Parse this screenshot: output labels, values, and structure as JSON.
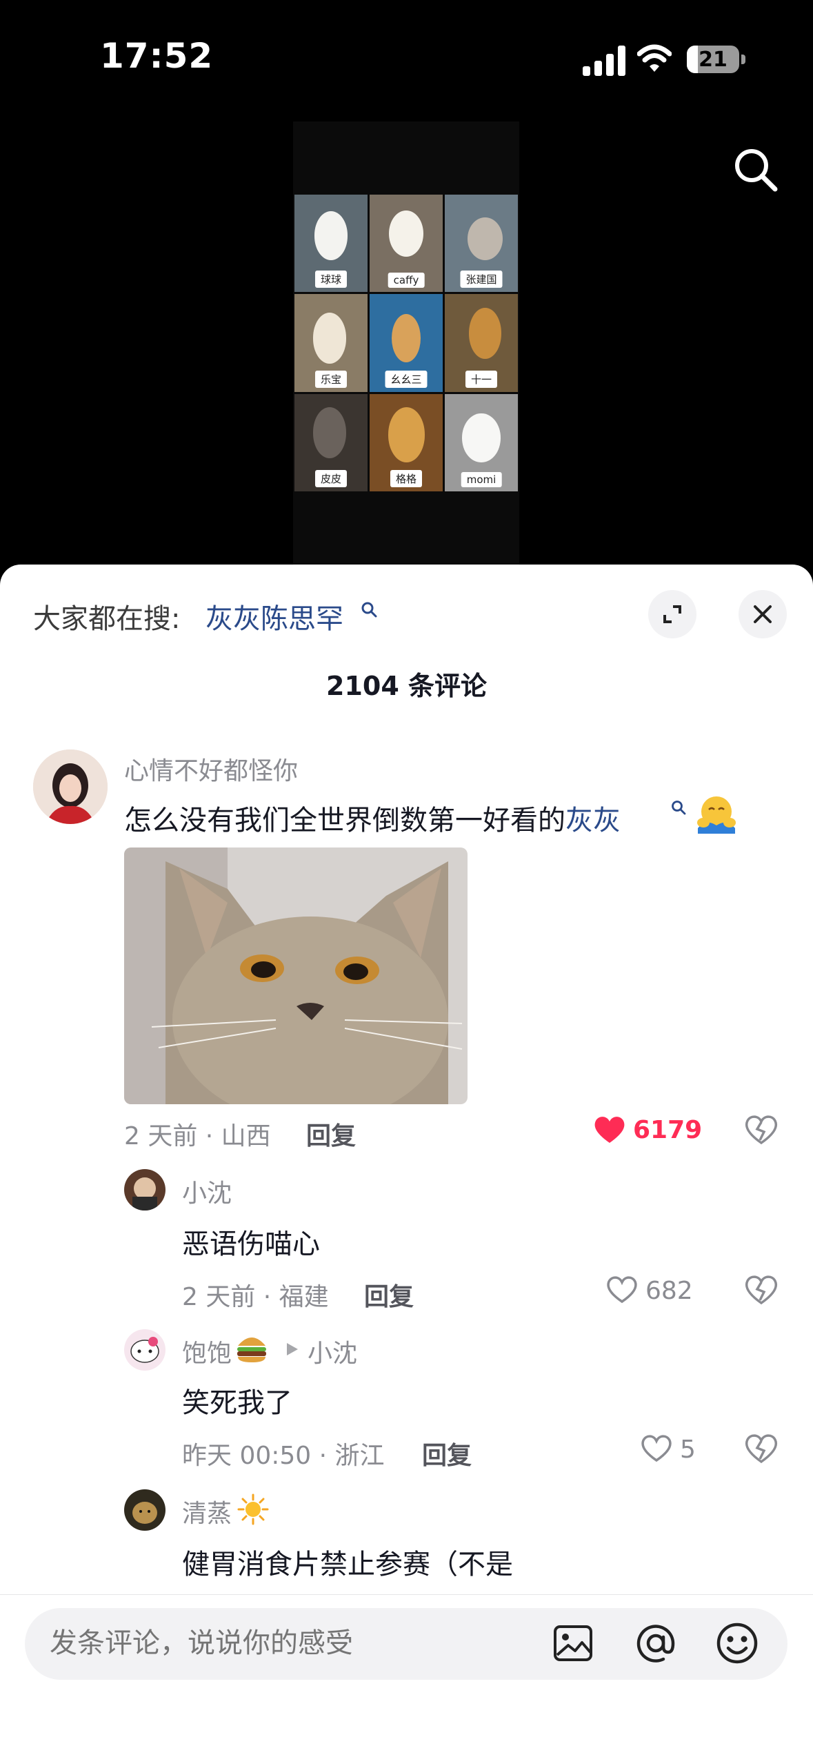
{
  "status_bar": {
    "time": "17:52",
    "battery": "21",
    "battery_level": 0.21
  },
  "video": {
    "dogs": [
      {
        "name": "球球",
        "bg": "#5d6a72",
        "fur": "#f3f3f0"
      },
      {
        "name": "caffy",
        "bg": "#7a6f62",
        "fur": "#f5f2ea"
      },
      {
        "name": "张建国",
        "bg": "#6b7b86",
        "fur": "#bfb7ad"
      },
      {
        "name": "乐宝",
        "bg": "#8a7c66",
        "fur": "#efe6d6"
      },
      {
        "name": "幺幺三",
        "bg": "#2e6ea0",
        "fur": "#d9a25a"
      },
      {
        "name": "十一",
        "bg": "#6f5a3c",
        "fur": "#c88d3e"
      },
      {
        "name": "皮皮",
        "bg": "#3b3530",
        "fur": "#6a625c"
      },
      {
        "name": "格格",
        "bg": "#7a4e25",
        "fur": "#d9a04a"
      },
      {
        "name": "momi",
        "bg": "#9a9a9a",
        "fur": "#f7f7f5"
      }
    ]
  },
  "comments_panel": {
    "hot_search_prefix": "大家都在搜:",
    "hot_search_term": "灰灰陈思罕",
    "title": "2104 条评论",
    "comments": [
      {
        "username": "心情不好都怪你",
        "text_before": "怎么没有我们全世界倒数第一好看的",
        "text_term": "灰灰",
        "meta": "2 天前 · 山西",
        "reply_label": "回复",
        "likes": "6179",
        "liked": true
      }
    ],
    "replies": [
      {
        "username": "小沈",
        "text": "恶语伤喵心",
        "meta": "2 天前 · 福建",
        "reply_label": "回复",
        "likes": "682"
      },
      {
        "username": "饱饱",
        "reply_to": "小沈",
        "text": "笑死我了",
        "meta": "昨天 00:50 · 浙江",
        "reply_label": "回复",
        "likes": "5"
      },
      {
        "username": "清蒸",
        "text": "健胃消食片禁止参赛（不是"
      }
    ]
  },
  "input_bar": {
    "placeholder": "发条评论，说说你的感受"
  },
  "colors": {
    "accent_red": "#fe2c55",
    "link_blue": "#2a4a8a",
    "muted_gray": "#8a8b91"
  }
}
